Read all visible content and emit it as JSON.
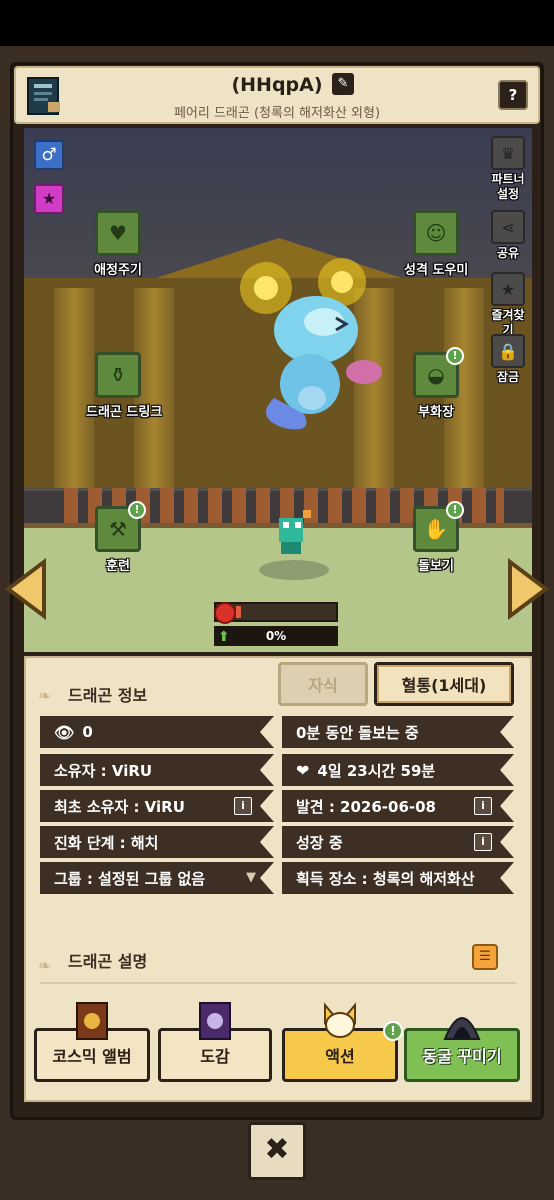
{
  "header": {
    "name": "(HHqpA)",
    "subtitle": "페어리 드래곤 (청록의 해저화산 외형)",
    "help_label": "?"
  },
  "scene": {
    "gender_symbol": "♂",
    "left_actions": [
      {
        "label": "애정주기",
        "icon": "heart-icon"
      },
      {
        "label": "드래곤 드링크",
        "icon": "bottle-icon"
      },
      {
        "label": "훈련",
        "icon": "dumbbell-icon",
        "alert": "!"
      }
    ],
    "right_actions": [
      {
        "label": "성격 도우미",
        "icon": "smile-icon"
      },
      {
        "label": "부화장",
        "icon": "nest-icon",
        "alert": "!"
      },
      {
        "label": "돌보기",
        "icon": "hand-icon",
        "alert": "!"
      }
    ],
    "side_menu": [
      {
        "label": "파트너\n설정",
        "icon": "crown-icon"
      },
      {
        "label": "공유",
        "icon": "share-icon"
      },
      {
        "label": "즐겨찾기",
        "icon": "star-icon"
      },
      {
        "label": "잠금",
        "icon": "lock-icon"
      }
    ],
    "mood_level": 0.05,
    "growth_text": "0%",
    "growth_level": 0
  },
  "info": {
    "section_title": "드래곤 정보",
    "tab_offspring": "자식",
    "tab_lineage": "혈통(1세대)",
    "views": "0",
    "care_status": "0분 동안 돌보는 중",
    "owner": "소유자 : ViRU",
    "time_left": "4일 23시간 59분",
    "first_owner": "최초 소유자 : ViRU",
    "found": "발견 : 2026-06-08",
    "evolution": "진화 단계 : 해치",
    "growing": "성장 중",
    "group": "그룹 : 설정된 그룹 없음",
    "acquired": "획득 장소 : 청록의 해저화산",
    "info_label": "i"
  },
  "description": {
    "section_title": "드래곤 설명"
  },
  "bottom": {
    "album": "코스믹 앨범",
    "dex": "도감",
    "action": "액션",
    "cave": "동굴 꾸미기",
    "action_alert": "!"
  },
  "colors": {
    "panel_bg": "#efe3c6",
    "row_bg": "#3d2f24",
    "action_btn": "#f6c94a",
    "cave_btn": "#7fbf54",
    "alert": "#5ea34b"
  }
}
